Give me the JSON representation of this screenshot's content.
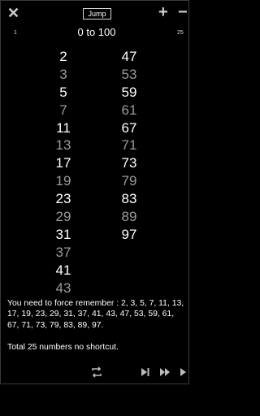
{
  "toolbar": {
    "jump_label": "Jump"
  },
  "header": {
    "range_start": "1",
    "range_label": "0 to 100",
    "range_end": "25"
  },
  "column_left": [
    "2",
    "3",
    "5",
    "7",
    "11",
    "13",
    "17",
    "19",
    "23",
    "29",
    "31",
    "37",
    "41",
    "43"
  ],
  "column_right": [
    "47",
    "53",
    "59",
    "61",
    "67",
    "71",
    "73",
    "79",
    "83",
    "89",
    "97"
  ],
  "note": "You need to force remember : 2, 3, 5, 7, 11, 13, 17, 19, 23, 29, 31, 37, 41, 43, 47, 53, 59, 61, 67, 71, 73, 79, 83, 89, 97.",
  "total": "Total 25 numbers no shortcut.",
  "icons": [
    "close-icon",
    "plus-icon",
    "minus-icon",
    "repeat-icon",
    "skip-next-icon",
    "fast-forward-icon",
    "play-icon"
  ]
}
